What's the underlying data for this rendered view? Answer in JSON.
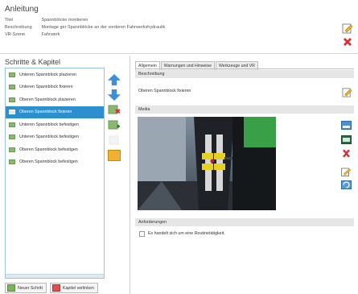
{
  "header": {
    "title": "Anleitung",
    "rows": [
      {
        "key": "Titel",
        "value": "Spannblöcke montieren"
      },
      {
        "key": "Beschreibung",
        "value": "Montage ger Spannblöcke an der vorderen Fahrwerkshydraulik"
      },
      {
        "key": "VR-Szene",
        "value": "Fahrwerk"
      }
    ]
  },
  "left": {
    "title": "Schritte & Kapitel",
    "items": [
      "Unteren Spannblock plazieren",
      "Unteren Spannblock fixieren",
      "Oberen Spannblock plazieren",
      "Oberen Spannblock fixieren",
      "Unteren Spannblock befestigen",
      "Unteren Spannblock befestigen",
      "Oberen Spannblock befestigen",
      "Oberen Spannblock befestigen"
    ],
    "selected_index": 3,
    "buttons": {
      "new_step": "Neuer Schritt",
      "link_chapter": "Kapitel verlinken"
    }
  },
  "right": {
    "tabs": [
      "Allgemein",
      "Warnungen und Hinweise",
      "Werkzeuge und VR"
    ],
    "active_tab": 0,
    "sections": {
      "description": "Beschreibung",
      "media": "Media",
      "requirements": "Anforderungen"
    },
    "description_text": "Oberen Spannblock fixieren",
    "routine_label": "Es handelt sich um eine Routinetätigkeit.",
    "routine_checked": false
  },
  "colors": {
    "selection": "#2b8fd0",
    "list_border": "#9cc3e0",
    "section_bg": "#e6e6e6"
  }
}
